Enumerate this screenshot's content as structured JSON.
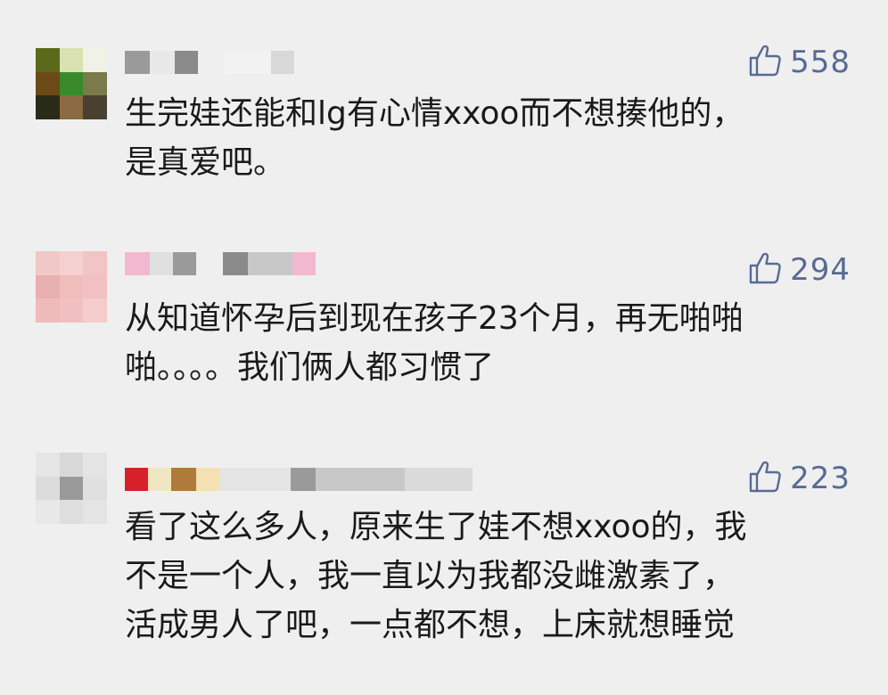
{
  "colors": {
    "background": "#efefef",
    "like_accent": "#576b95",
    "text": "#1a1a1a"
  },
  "comments": [
    {
      "likes": "558",
      "content": "生完娃还能和lg有心情xxoo而不想揍他的，\n是真爱吧。",
      "avatar_colors": [
        "#5a6a1a",
        "#d9e2b0",
        "#f1f1e8",
        "#6b4a18",
        "#3a8a2a",
        "#7a7a4a",
        "#2a2a18",
        "#8a6a40",
        "#4a4030"
      ],
      "name_colors": [
        "#9a9a9a",
        "#e8e8e8",
        "#8a8a8a",
        "#efefef",
        "#f2f2f2",
        "#d8d8d8"
      ]
    },
    {
      "likes": "294",
      "content": "从知道怀孕后到现在孩子23个月，再无啪啪\n啪。。。。我们俩人都习惯了",
      "avatar_colors": [
        "#f0c8c8",
        "#f4d0d0",
        "#f2c4c4",
        "#e8b0b0",
        "#f0bcbc",
        "#f2c0c0",
        "#eebaba",
        "#f0c0c0",
        "#f4cccc"
      ],
      "name_colors": [
        "#f2b8d0",
        "#e0e0e0",
        "#9a9a9a",
        "#efefef",
        "#8a8a8a",
        "#c8c8c8",
        "#f2b8d0"
      ]
    },
    {
      "likes": "223",
      "content": "看了这么多人，原来生了娃不想xxoo的，我\n不是一个人，我一直以为我都没雌激素了，\n活成男人了吧，一点都不想，上床就想睡觉",
      "avatar_colors": [
        "#e6e6e6",
        "#d8d8d8",
        "#e4e4e4",
        "#dcdcdc",
        "#9a9a9a",
        "#e0e0e0",
        "#e8e8e8",
        "#dedede",
        "#e4e4e4"
      ],
      "name_colors": [
        "#d8202a",
        "#f0e6c0",
        "#b07a3a",
        "#f4e0b0",
        "#e4e4e4",
        "#9a9a9a",
        "#c8c8c8",
        "#dadada"
      ]
    }
  ]
}
